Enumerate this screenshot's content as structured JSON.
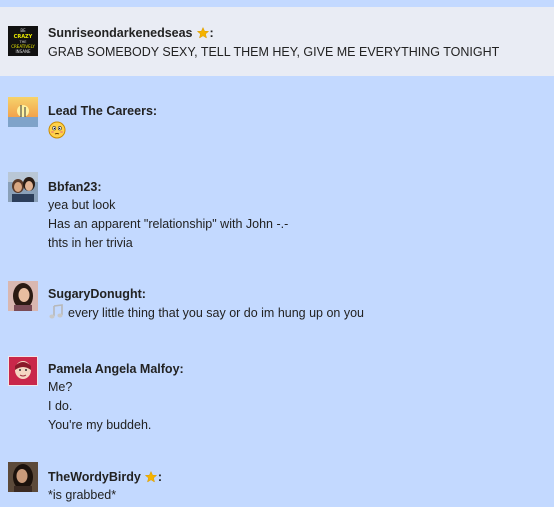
{
  "posts": [
    {
      "author": "Sunriseondarkenedseas",
      "starred": true,
      "avatar_icon": "crazy-creatively-insane-avatar",
      "avatar_text": [
        "BE",
        "CRAZY",
        "THE",
        "CREATIVELY",
        "INSANE"
      ],
      "lines": [
        "GRAB SOMEBODY SEXY, TELL THEM HEY, GIVE ME EVERYTHING TONIGHT"
      ]
    },
    {
      "author": "Lead The Careers",
      "starred": false,
      "avatar_icon": "sunset-avatar",
      "emoji": "blushing-smiley-icon",
      "lines": []
    },
    {
      "author": "Bbfan23",
      "starred": false,
      "avatar_icon": "couple-photo-avatar",
      "lines": [
        "yea but look",
        "Has an apparent \"relationship\" with John -.-",
        "thts in her trivia"
      ]
    },
    {
      "author": "SugaryDonught",
      "starred": false,
      "avatar_icon": "girl-photo-avatar",
      "music_note": "music-note-icon",
      "lines": [
        "every little thing that you say or do im hung up on you"
      ]
    },
    {
      "author": "Pamela Angela Malfoy",
      "starred": false,
      "avatar_icon": "face-photo-avatar",
      "lines": [
        "Me?",
        "I do.",
        "You're my buddeh."
      ]
    },
    {
      "author": "TheWordyBirdy",
      "starred": true,
      "avatar_icon": "girl-photo-avatar",
      "lines": [
        "*is grabbed*"
      ]
    }
  ],
  "colors": {
    "background": "#c3d9ff",
    "highlight_row": "#e9ecf4",
    "star": "#f5b300"
  }
}
